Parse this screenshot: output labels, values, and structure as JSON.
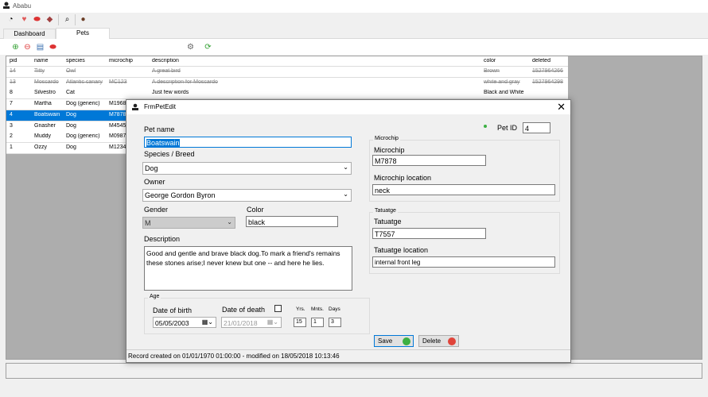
{
  "app": {
    "title": "Ababu"
  },
  "tabs": [
    {
      "label": "Dashboard"
    },
    {
      "label": "Pets"
    }
  ],
  "grid": {
    "columns": [
      "pid",
      "name",
      "species",
      "microchip",
      "description",
      "color",
      "deleted"
    ],
    "rows": [
      {
        "pid": "14",
        "name": "Titty",
        "species": "Owl",
        "microchip": "",
        "description": "A great bird",
        "color": "Brown",
        "deleted": "1527964266"
      },
      {
        "pid": "13",
        "name": "Moscardo",
        "species": "Atlantic canary",
        "microchip": "MC123",
        "description": "A description for Moscardo",
        "color": "white and gray",
        "deleted": "1527964298"
      },
      {
        "pid": "8",
        "name": "Silvestro",
        "species": "Cat",
        "microchip": "",
        "description": "Just few words",
        "color": "Black and White",
        "deleted": ""
      },
      {
        "pid": "7",
        "name": "Martha",
        "species": "Dog (generic)",
        "microchip": "M1968",
        "description": "",
        "color": "",
        "deleted": ""
      },
      {
        "pid": "4",
        "name": "Boatswain",
        "species": "Dog",
        "microchip": "M7878",
        "description": "",
        "color": "",
        "deleted": ""
      },
      {
        "pid": "3",
        "name": "Gnasher",
        "species": "Dog",
        "microchip": "M4545",
        "description": "",
        "color": "",
        "deleted": ""
      },
      {
        "pid": "2",
        "name": "Muddy",
        "species": "Dog (generic)",
        "microchip": "M0987",
        "description": "",
        "color": "",
        "deleted": ""
      },
      {
        "pid": "1",
        "name": "Ozzy",
        "species": "Dog",
        "microchip": "M1234",
        "description": "",
        "color": "",
        "deleted": ""
      }
    ]
  },
  "dialog": {
    "title": "FrmPetEdit",
    "pet_name_label": "Pet name",
    "pet_name": "Boatswain",
    "species_label": "Species / Breed",
    "species": "Dog",
    "owner_label": "Owner",
    "owner": "George Gordon Byron",
    "gender_label": "Gender",
    "gender": "M",
    "color_label": "Color",
    "color": "black",
    "description_label": "Description",
    "description": "Good and gentle and brave black dog.To mark a friend's remains these stones arise;I never knew but one -- and here he lies.",
    "pet_id_label": "Pet ID",
    "pet_id": "4",
    "microchip_group": "Microchip",
    "microchip_label": "Microchip",
    "microchip": "M7878",
    "microchip_location_label": "Microchip location",
    "microchip_location": "neck",
    "tatuatge_group": "Tatuatge",
    "tatuatge_label": "Tatuatge",
    "tatuatge": "T7557",
    "tatuatge_location_label": "Tatuatge location",
    "tatuatge_location": "internal front leg",
    "age_group": "Age",
    "dob_label": "Date of birth",
    "dob": "05/05/2003",
    "dod_label": "Date of death",
    "dod": "21/01/2018",
    "yrs_label": "Yrs.",
    "mnts_label": "Mnts.",
    "days_label": "Days",
    "yrs": "15",
    "mnts": "1",
    "days": "3",
    "save_label": "Save",
    "delete_label": "Delete",
    "status": "Record created on 01/01/1970 01:00:00 - modified on 18/05/2018 10:13:46"
  },
  "colors": {
    "selection": "#0078d7",
    "save_icon": "#3cb043",
    "delete_icon": "#e0443a"
  }
}
